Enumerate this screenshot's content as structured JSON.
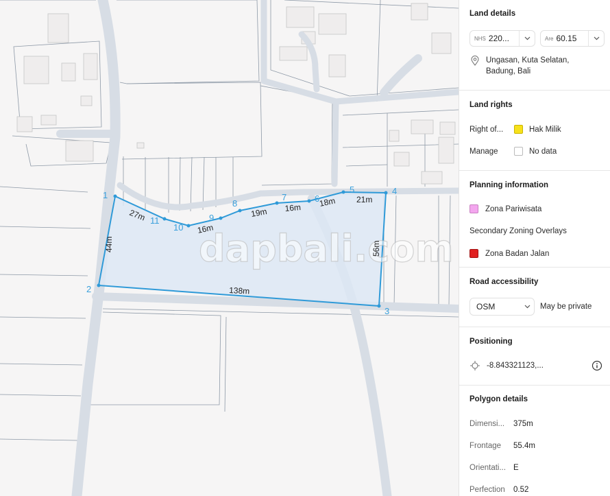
{
  "map": {
    "watermark": "dapbali.com",
    "vertices": [
      {
        "label": "1"
      },
      {
        "label": "2"
      },
      {
        "label": "3"
      },
      {
        "label": "4"
      },
      {
        "label": "5"
      },
      {
        "label": "6"
      },
      {
        "label": "7"
      },
      {
        "label": "8"
      },
      {
        "label": "9"
      },
      {
        "label": "10"
      },
      {
        "label": "11"
      }
    ],
    "edge_lengths": [
      "27m",
      "44m",
      "138m",
      "56m",
      "21m",
      "18m",
      "16m",
      "19m",
      "16m"
    ],
    "colors": {
      "polygon_fill": "#dde8f5",
      "polygon_stroke": "#2f9ad8",
      "road": "#d6dde6"
    }
  },
  "panel": {
    "land_details": {
      "title": "Land details",
      "nhs_prefix": "NHS",
      "nhs_value": "220...",
      "area_prefix": "Are",
      "area_value": "60.15",
      "location": [
        "Ungasan, Kuta Selatan,",
        "Badung, Bali"
      ]
    },
    "land_rights": {
      "title": "Land rights",
      "right_label": "Right of...",
      "right_value": "Hak Milik",
      "right_color": "#f7e11b",
      "manage_label": "Manage",
      "manage_value": "No data",
      "manage_color": "#ffffff"
    },
    "planning": {
      "title": "Planning information",
      "zone": "Zona Pariwisata",
      "zone_color": "#f3a6ee",
      "overlays_title": "Secondary Zoning Overlays",
      "overlay": "Zona Badan Jalan",
      "overlay_color": "#e02020"
    },
    "road": {
      "title": "Road accessibility",
      "source": "OSM",
      "status": "May be private"
    },
    "positioning": {
      "title": "Positioning",
      "coords": "-8.843321123,..."
    },
    "polygon": {
      "title": "Polygon details",
      "rows": [
        {
          "label": "Dimensi...",
          "value": "375m"
        },
        {
          "label": "Frontage",
          "value": "55.4m"
        },
        {
          "label": "Orientati...",
          "value": "E"
        },
        {
          "label": "Perfection",
          "value": "0.52"
        }
      ]
    }
  }
}
